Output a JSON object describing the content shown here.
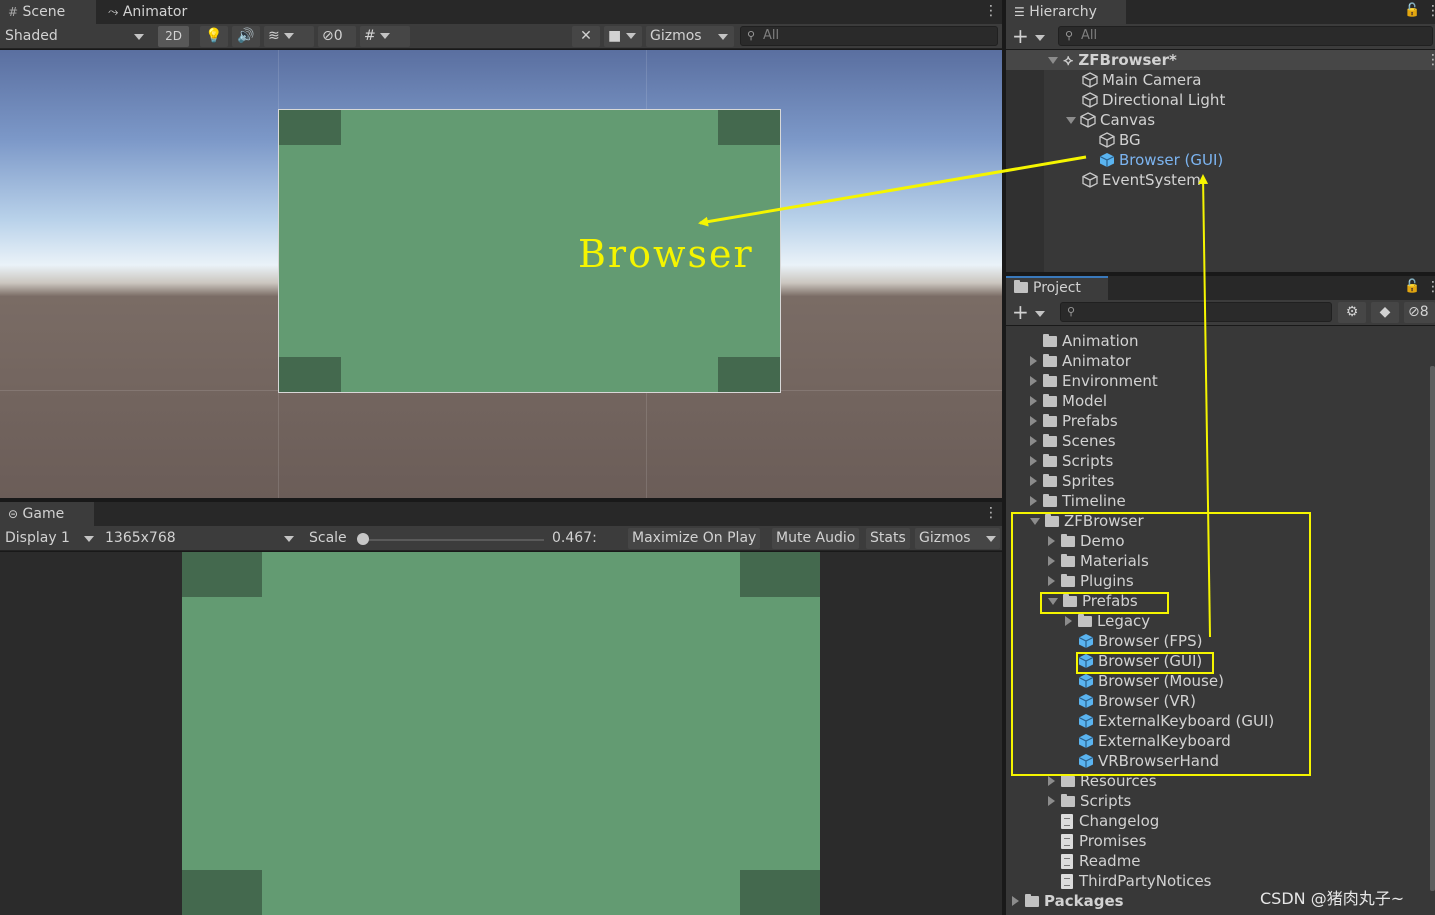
{
  "scene_panel": {
    "tabs": [
      "Scene",
      "Animator"
    ],
    "shading_mode": "Shaded",
    "btn_2d": "2D",
    "hidden_count": "0",
    "gizmos_label": "Gizmos",
    "search_placeholder": "All",
    "annotation_text": "Browser"
  },
  "game_panel": {
    "tab": "Game",
    "display": "Display 1",
    "resolution": "1365x768",
    "scale_label": "Scale",
    "scale_value": "0.467:",
    "maximize": "Maximize On Play",
    "mute": "Mute Audio",
    "stats": "Stats",
    "gizmos": "Gizmos"
  },
  "hierarchy": {
    "tab": "Hierarchy",
    "search_placeholder": "All",
    "scene_name": "ZFBrowser*",
    "items": [
      "Main Camera",
      "Directional Light",
      "Canvas",
      "BG",
      "Browser (GUI)",
      "EventSystem"
    ]
  },
  "project": {
    "tab": "Project",
    "hidden_count": "8",
    "folders_top": [
      "Animation",
      "Animator",
      "Environment",
      "Model",
      "Prefabs",
      "Scenes",
      "Scripts",
      "Sprites",
      "Timeline"
    ],
    "zf_folder": "ZFBrowser",
    "zf_children": [
      "Demo",
      "Materials",
      "Plugins"
    ],
    "prefabs_folder": "Prefabs",
    "legacy_folder": "Legacy",
    "prefab_items": [
      "Browser (FPS)",
      "Browser (GUI)",
      "Browser (Mouse)",
      "Browser (VR)",
      "ExternalKeyboard (GUI)",
      "ExternalKeyboard",
      "VRBrowserHand"
    ],
    "zf_more_folders": [
      "Resources",
      "Scripts"
    ],
    "zf_files": [
      "Changelog",
      "Promises",
      "Readme",
      "ThirdPartyNotices"
    ],
    "packages": "Packages"
  },
  "watermark": "CSDN @猪肉丸子~",
  "colors": {
    "accent_blue": "#3a79bb",
    "highlight_yellow": "#f5f500",
    "browser_green": "#639b72",
    "prefab_blue": "#5ab4f0"
  }
}
